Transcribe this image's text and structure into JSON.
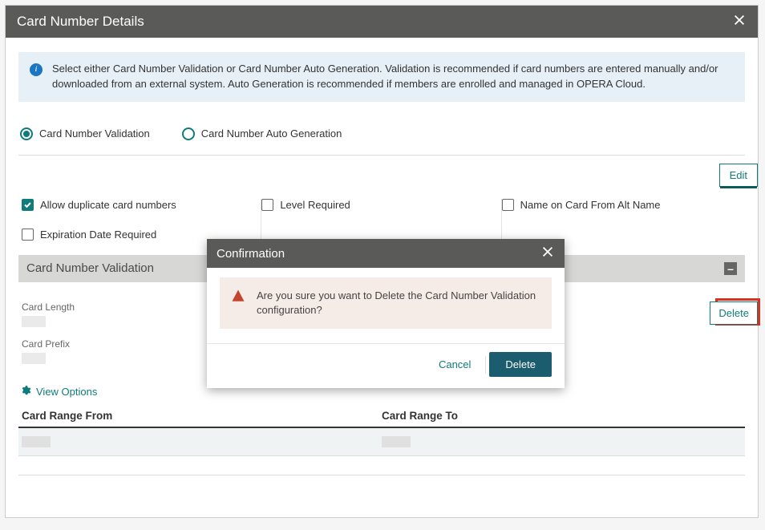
{
  "header": {
    "title": "Card Number Details"
  },
  "info": {
    "text": "Select either Card Number Validation or Card Number Auto Generation. Validation is recommended if card numbers are entered manually and/or downloaded from an external system. Auto Generation is recommended if members are enrolled and managed in OPERA Cloud."
  },
  "mode": {
    "validation": "Card Number Validation",
    "auto": "Card Number Auto Generation"
  },
  "buttons": {
    "edit": "Edit",
    "delete": "Delete"
  },
  "checks": {
    "dup": "Allow duplicate card numbers",
    "exp": "Expiration Date Required",
    "level": "Level Required",
    "altname": "Name on Card From Alt Name"
  },
  "section": {
    "title": "Card Number Validation"
  },
  "fields": {
    "length_lbl": "Card Length",
    "prefix_lbl": "Card Prefix"
  },
  "view_options": "View Options",
  "table": {
    "from": "Card Range From",
    "to": "Card Range To"
  },
  "modal": {
    "title": "Confirmation",
    "message": "Are you sure you want to Delete the Card Number Validation configuration?",
    "cancel": "Cancel",
    "confirm": "Delete"
  }
}
